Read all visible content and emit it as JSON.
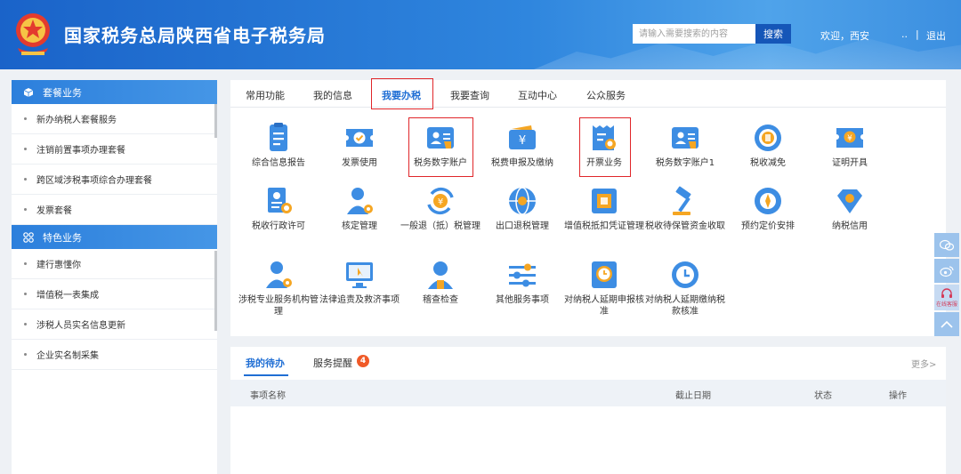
{
  "header": {
    "title": "国家税务总局陕西省电子税务局",
    "search_placeholder": "请输入需要搜索的内容",
    "search_button": "搜索",
    "welcome": "欢迎，西安",
    "welcome_dots": "..",
    "separator": "|",
    "logout": "退出"
  },
  "sidebar": {
    "group1": {
      "title": "套餐业务",
      "items": [
        "新办纳税人套餐服务",
        "注销前置事项办理套餐",
        "跨区域涉税事项综合办理套餐",
        "发票套餐"
      ]
    },
    "group2": {
      "title": "特色业务",
      "items": [
        "建行惠懂你",
        "增值税一表集成",
        "涉税人员实名信息更新",
        "企业实名制采集"
      ]
    }
  },
  "tabs": [
    "常用功能",
    "我的信息",
    "我要办税",
    "我要查询",
    "互动中心",
    "公众服务"
  ],
  "tiles": [
    {
      "label": "综合信息报告",
      "icon": "report-icon"
    },
    {
      "label": "发票使用",
      "icon": "invoice-icon"
    },
    {
      "label": "税务数字账户",
      "icon": "digital-account-icon"
    },
    {
      "label": "税费申报及缴纳",
      "icon": "wallet-yuan-icon"
    },
    {
      "label": "开票业务",
      "icon": "invoicing-icon"
    },
    {
      "label": "税务数字账户1",
      "icon": "digital-account-icon"
    },
    {
      "label": "税收减免",
      "icon": "coin-icon"
    },
    {
      "label": "证明开具",
      "icon": "certificate-icon"
    },
    {
      "label": "税收行政许可",
      "icon": "permit-icon"
    },
    {
      "label": "核定管理",
      "icon": "person-gear-icon"
    },
    {
      "label": "一般退（抵）税管理",
      "icon": "refund-icon"
    },
    {
      "label": "出口退税管理",
      "icon": "globe-icon"
    },
    {
      "label": "增值税抵扣凭证管理",
      "icon": "voucher-icon"
    },
    {
      "label": "税收待保管资金收取",
      "icon": "gavel-icon"
    },
    {
      "label": "预约定价安排",
      "icon": "compass-icon"
    },
    {
      "label": "纳税信用",
      "icon": "diamond-icon"
    },
    {
      "label": "涉税专业服务机构管理",
      "icon": "person-gear-icon"
    },
    {
      "label": "法律追责及救济事项",
      "icon": "monitor-icon"
    },
    {
      "label": "稽查检查",
      "icon": "person-icon"
    },
    {
      "label": "其他服务事项",
      "icon": "sliders-icon"
    },
    {
      "label": "对纳税人延期申报核准",
      "icon": "clock-icon"
    },
    {
      "label": "对纳税人延期缴纳税款核准",
      "icon": "clock-icon"
    }
  ],
  "tasks": {
    "tabs": [
      "我的待办",
      "服务提醒"
    ],
    "badge": "4",
    "more": "更多>",
    "columns": [
      "事项名称",
      "截止日期",
      "状态",
      "操作"
    ]
  },
  "floating": {
    "online_text": "在线客服"
  },
  "colors": {
    "header": "#2a7bd8",
    "accent": "#1f6ed4",
    "icon_blue": "#3d8de3",
    "icon_orange": "#f5a623",
    "highlight_red": "#e0262a"
  }
}
